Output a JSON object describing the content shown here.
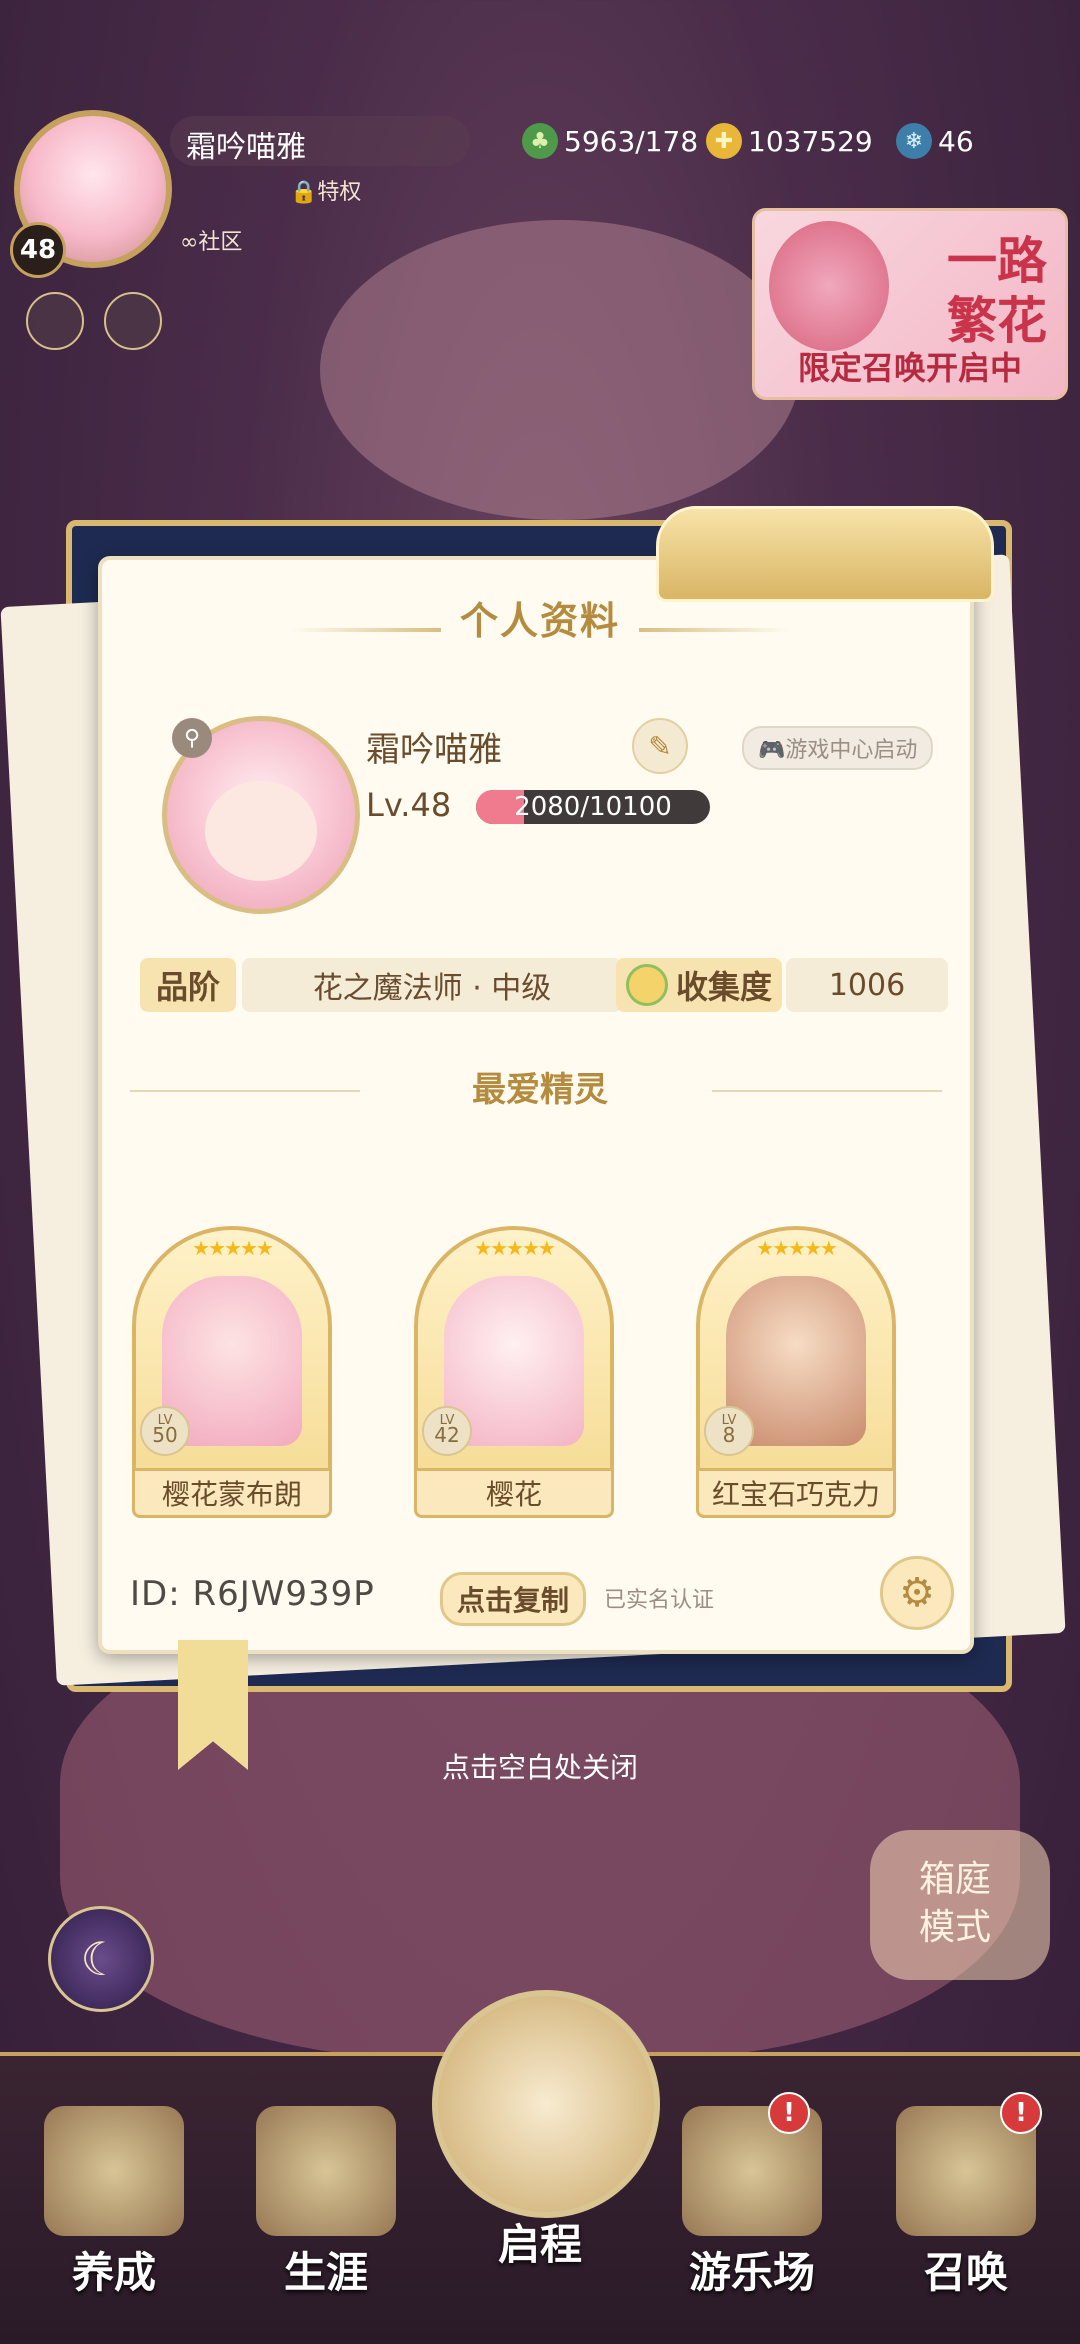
{
  "hud": {
    "player_name": "霜吟喵雅",
    "level": "48",
    "privilege": "特权",
    "community": "社区",
    "resources": [
      {
        "icon": "clover-icon",
        "value": "5963/178"
      },
      {
        "icon": "gold-coin-icon",
        "value": "1037529"
      },
      {
        "icon": "snowflake-gem-icon",
        "value": "46"
      }
    ]
  },
  "event_banner": {
    "title_line1": "一路",
    "title_line2": "繁花",
    "subtitle": "限定召唤开启中"
  },
  "profile": {
    "title": "个人资料",
    "name": "霜吟喵雅",
    "game_center": "游戏中心启动",
    "level_label": "Lv.48",
    "exp_text": "2080/10100",
    "exp_fraction": 0.206,
    "rank_label": "品阶",
    "rank_value": "花之魔法师 · 中级",
    "collection_label": "收集度",
    "collection_value": "1006",
    "favorites_title": "最爱精灵",
    "sprites": [
      {
        "name": "樱花蒙布朗",
        "lv_label": "LV",
        "lv": "50",
        "stars": "★★★★★"
      },
      {
        "name": "樱花",
        "lv_label": "LV",
        "lv": "42",
        "stars": "★★★★★"
      },
      {
        "name": "红宝石巧克力",
        "lv_label": "LV",
        "lv": "8",
        "stars": "★★★★★"
      }
    ],
    "id_label": "ID:",
    "id_value": "R6JW939P",
    "copy_button": "点击复制",
    "verified": "已实名认证"
  },
  "close_hint": "点击空白处关闭",
  "yard_mode": {
    "line1": "箱庭",
    "line2": "模式"
  },
  "nav": {
    "items": [
      {
        "label": "养成",
        "badge": ""
      },
      {
        "label": "生涯",
        "badge": ""
      },
      {
        "label": "启程",
        "badge": ""
      },
      {
        "label": "游乐场",
        "badge": "!"
      },
      {
        "label": "召唤",
        "badge": "!"
      }
    ]
  },
  "colors": {
    "accent_gold": "#b48b3f",
    "exp_fill": "#f07a8e",
    "event_red": "#c9344a"
  }
}
